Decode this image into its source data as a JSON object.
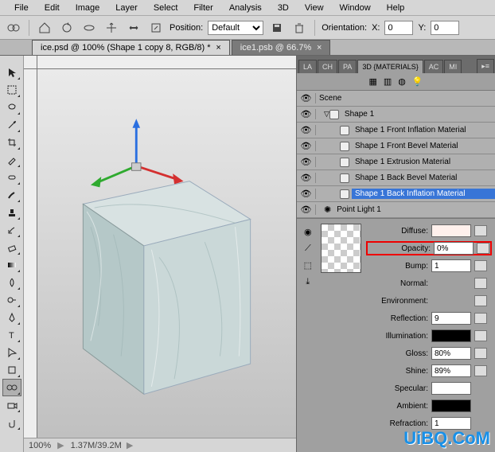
{
  "menu": {
    "items": [
      "File",
      "Edit",
      "Image",
      "Layer",
      "Select",
      "Filter",
      "Analysis",
      "3D",
      "View",
      "Window",
      "Help"
    ]
  },
  "options": {
    "position_label": "Position:",
    "position_value": "Default",
    "orientation_label": "Orientation:",
    "x_label": "X:",
    "x_value": "0",
    "y_label": "Y:",
    "y_value": "0"
  },
  "tabs": [
    {
      "label": "ice.psd @ 100% (Shape 1 copy 8, RGB/8) *",
      "active": true
    },
    {
      "label": "ice1.psb @ 66.7%",
      "active": false
    }
  ],
  "status": {
    "zoom": "100%",
    "info": "1.37M/39.2M"
  },
  "panel_tabs": [
    "LA",
    "CH",
    "PA",
    "3D {MATERIALS}",
    "AC",
    "MI"
  ],
  "panel_active": 3,
  "scene": {
    "root": "Scene",
    "items": [
      {
        "name": "Shape 1",
        "depth": 1,
        "toggle": true,
        "icon": "mesh"
      },
      {
        "name": "Shape 1 Front Inflation Material",
        "depth": 2,
        "icon": "mat"
      },
      {
        "name": "Shape 1 Front Bevel Material",
        "depth": 2,
        "icon": "mat"
      },
      {
        "name": "Shape 1 Extrusion Material",
        "depth": 2,
        "icon": "mat"
      },
      {
        "name": "Shape 1 Back Bevel Material",
        "depth": 2,
        "icon": "mat"
      },
      {
        "name": "Shape 1 Back Inflation Material",
        "depth": 2,
        "icon": "mat",
        "selected": true
      },
      {
        "name": "Point Light 1",
        "depth": 1,
        "icon": "light"
      }
    ]
  },
  "materials": {
    "diffuse": {
      "label": "Diffuse:",
      "color": "#fff0ec"
    },
    "opacity": {
      "label": "Opacity:",
      "value": "0%"
    },
    "bump": {
      "label": "Bump:",
      "value": "1"
    },
    "normal": {
      "label": "Normal:"
    },
    "environment": {
      "label": "Environment:"
    },
    "reflection": {
      "label": "Reflection:",
      "value": "9"
    },
    "illumination": {
      "label": "Illumination:",
      "color": "#000000"
    },
    "gloss": {
      "label": "Gloss:",
      "value": "80%"
    },
    "shine": {
      "label": "Shine:",
      "value": "89%"
    },
    "specular": {
      "label": "Specular:",
      "color": "#ffffff"
    },
    "ambient": {
      "label": "Ambient:",
      "color": "#000000"
    },
    "refraction": {
      "label": "Refraction:",
      "value": "1"
    }
  },
  "watermark": "UiBQ.CoM"
}
